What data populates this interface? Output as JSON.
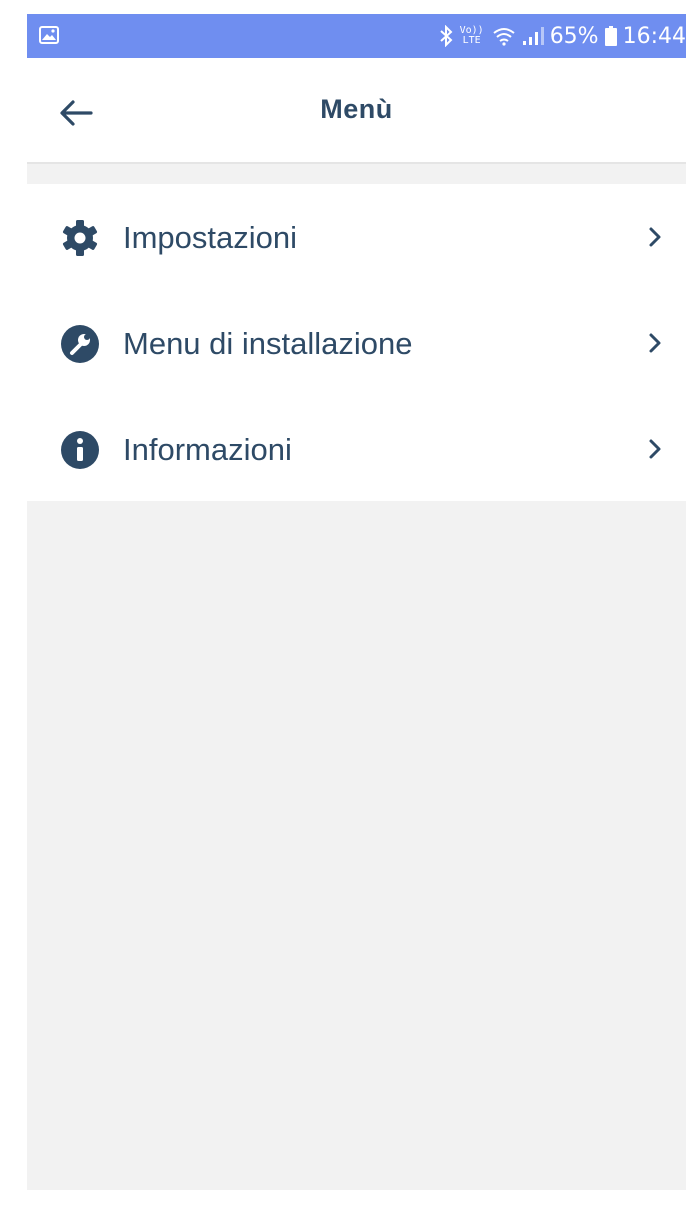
{
  "status_bar": {
    "battery_percent": "65%",
    "time": "16:44",
    "volte_top": "Vo))",
    "volte_bottom": "LTE",
    "icons": [
      "gallery-icon",
      "bluetooth-icon",
      "wifi-icon",
      "signal-icon",
      "battery-icon"
    ]
  },
  "header": {
    "title": "Menù",
    "back_icon": "arrow-left-icon"
  },
  "menu": {
    "items": [
      {
        "label": "Impostazioni",
        "icon": "gear-icon"
      },
      {
        "label": "Menu di installazione",
        "icon": "wrench-icon"
      },
      {
        "label": "Informazioni",
        "icon": "info-icon"
      }
    ]
  },
  "colors": {
    "status_bar": "#6f8ef0",
    "primary_text": "#2e4a66",
    "background": "#f2f2f2",
    "card": "#ffffff"
  }
}
